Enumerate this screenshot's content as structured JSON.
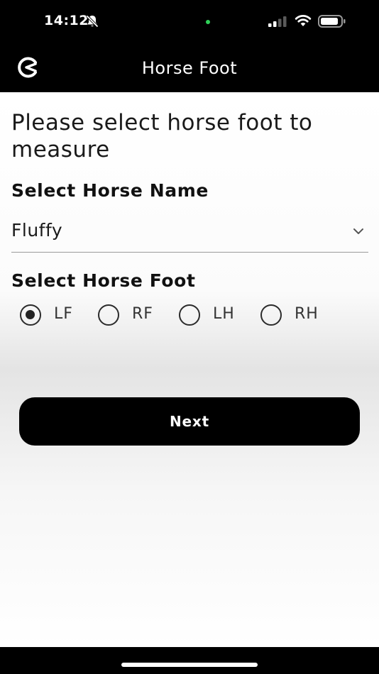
{
  "status_bar": {
    "time": "14:12",
    "icons": [
      "bell-off-icon",
      "signal-icon",
      "wifi-icon",
      "battery-icon"
    ]
  },
  "app_bar": {
    "title": "Horse Foot",
    "back_icon": "back-icon"
  },
  "main": {
    "prompt": "Please select horse foot to measure",
    "horse_name": {
      "label": "Select Horse Name",
      "selected_value": "Fluffy"
    },
    "horse_foot": {
      "label": "Select Horse Foot",
      "selected": "LF",
      "options": [
        {
          "label": "LF",
          "checked": true
        },
        {
          "label": "RF",
          "checked": false
        },
        {
          "label": "LH",
          "checked": false
        },
        {
          "label": "RH",
          "checked": false
        }
      ]
    },
    "next_label": "Next"
  },
  "colors": {
    "bar_background": "#000000",
    "button_background": "#000000",
    "button_text": "#ffffff",
    "page_background": "#ffffff",
    "status_dot": "#2fd158"
  }
}
